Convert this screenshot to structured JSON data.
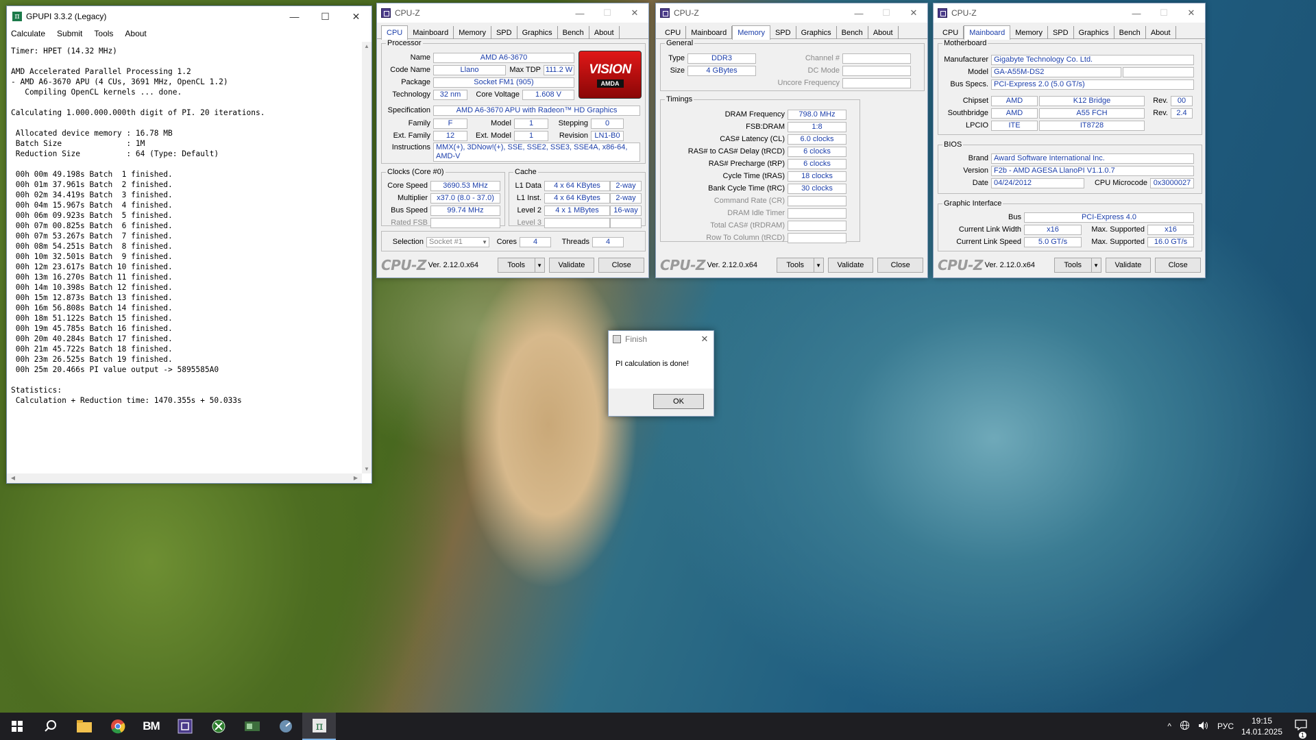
{
  "gpupi": {
    "title": "GPUPI 3.3.2 (Legacy)",
    "menu": [
      "Calculate",
      "Submit",
      "Tools",
      "About"
    ],
    "log": [
      "Timer: HPET (14.32 MHz)",
      "",
      "AMD Accelerated Parallel Processing 1.2",
      "- AMD A6-3670 APU (4 CUs, 3691 MHz, OpenCL 1.2)",
      "   Compiling OpenCL kernels ... done.",
      "",
      "Calculating 1.000.000.000th digit of PI. 20 iterations.",
      "",
      " Allocated device memory : 16.78 MB",
      " Batch Size              : 1M",
      " Reduction Size          : 64 (Type: Default)",
      "",
      " 00h 00m 49.198s Batch  1 finished.",
      " 00h 01m 37.961s Batch  2 finished.",
      " 00h 02m 34.419s Batch  3 finished.",
      " 00h 04m 15.967s Batch  4 finished.",
      " 00h 06m 09.923s Batch  5 finished.",
      " 00h 07m 00.825s Batch  6 finished.",
      " 00h 07m 53.267s Batch  7 finished.",
      " 00h 08m 54.251s Batch  8 finished.",
      " 00h 10m 32.501s Batch  9 finished.",
      " 00h 12m 23.617s Batch 10 finished.",
      " 00h 13m 16.270s Batch 11 finished.",
      " 00h 14m 10.398s Batch 12 finished.",
      " 00h 15m 12.873s Batch 13 finished.",
      " 00h 16m 56.808s Batch 14 finished.",
      " 00h 18m 51.122s Batch 15 finished.",
      " 00h 19m 45.785s Batch 16 finished.",
      " 00h 20m 40.284s Batch 17 finished.",
      " 00h 21m 45.722s Batch 18 finished.",
      " 00h 23m 26.525s Batch 19 finished.",
      " 00h 25m 20.466s PI value output -> 5895585A0",
      "",
      "Statistics:",
      " Calculation + Reduction time: 1470.355s + 50.033s"
    ]
  },
  "cpuz_common": {
    "title": "CPU-Z",
    "tabs": [
      "CPU",
      "Mainboard",
      "Memory",
      "SPD",
      "Graphics",
      "Bench",
      "About"
    ],
    "logo": "CPU-Z",
    "version": "Ver. 2.12.0.x64",
    "tools": "Tools",
    "validate": "Validate",
    "close": "Close"
  },
  "cpu": {
    "processor_legend": "Processor",
    "name_label": "Name",
    "name": "AMD A6-3670",
    "codename_label": "Code Name",
    "codename": "Llano",
    "maxtdp_label": "Max TDP",
    "maxtdp": "111.2 W",
    "package_label": "Package",
    "package": "Socket FM1 (905)",
    "technology_label": "Technology",
    "technology": "32 nm",
    "voltage_label": "Core Voltage",
    "voltage": "1.608 V",
    "spec_label": "Specification",
    "spec": "AMD A6-3670 APU with Radeon™ HD Graphics",
    "family_label": "Family",
    "family": "F",
    "model_label": "Model",
    "model": "1",
    "stepping_label": "Stepping",
    "stepping": "0",
    "extfamily_label": "Ext. Family",
    "extfamily": "12",
    "extmodel_label": "Ext. Model",
    "extmodel": "1",
    "revision_label": "Revision",
    "revision": "LN1-B0",
    "instructions_label": "Instructions",
    "instructions": "MMX(+), 3DNow!(+), SSE, SSE2, SSE3, SSE4A, x86-64, AMD-V",
    "logo_text": "VISION",
    "logo_sub": "AMDA",
    "clocks_legend": "Clocks (Core #0)",
    "corespeed_label": "Core Speed",
    "corespeed": "3690.53 MHz",
    "multiplier_label": "Multiplier",
    "multiplier": "x37.0 (8.0 - 37.0)",
    "busspeed_label": "Bus Speed",
    "busspeed": "99.74 MHz",
    "ratedfsb_label": "Rated FSB",
    "cache_legend": "Cache",
    "l1d_label": "L1 Data",
    "l1d": "4 x 64 KBytes",
    "l1d_way": "2-way",
    "l1i_label": "L1 Inst.",
    "l1i": "4 x 64 KBytes",
    "l1i_way": "2-way",
    "l2_label": "Level 2",
    "l2": "4 x 1 MBytes",
    "l2_way": "16-way",
    "l3_label": "Level 3",
    "selection_label": "Selection",
    "selection": "Socket #1",
    "cores_label": "Cores",
    "cores": "4",
    "threads_label": "Threads",
    "threads": "4"
  },
  "memory": {
    "general_legend": "General",
    "type_label": "Type",
    "type": "DDR3",
    "size_label": "Size",
    "size": "4 GBytes",
    "channel_label": "Channel #",
    "dcmode_label": "DC Mode",
    "uncore_label": "Uncore Frequency",
    "timings_legend": "Timings",
    "dram_freq_label": "DRAM Frequency",
    "dram_freq": "798.0 MHz",
    "fsb_dram_label": "FSB:DRAM",
    "fsb_dram": "1:8",
    "cl_label": "CAS# Latency (CL)",
    "cl": "6.0 clocks",
    "trcd_label": "RAS# to CAS# Delay (tRCD)",
    "trcd": "6 clocks",
    "trp_label": "RAS# Precharge (tRP)",
    "trp": "6 clocks",
    "tras_label": "Cycle Time (tRAS)",
    "tras": "18 clocks",
    "trc_label": "Bank Cycle Time (tRC)",
    "trc": "30 clocks",
    "cr_label": "Command Rate (CR)",
    "idle_label": "DRAM Idle Timer",
    "trdram_label": "Total CAS# (tRDRAM)",
    "trcd2_label": "Row To Column (tRCD)"
  },
  "mainboard": {
    "mb_legend": "Motherboard",
    "manufacturer_label": "Manufacturer",
    "manufacturer": "Gigabyte Technology Co. Ltd.",
    "model_label": "Model",
    "model": "GA-A55M-DS2",
    "busspecs_label": "Bus Specs.",
    "busspecs": "PCI-Express 2.0 (5.0 GT/s)",
    "chipset_label": "Chipset",
    "chipset_vendor": "AMD",
    "chipset": "K12 Bridge",
    "chipset_rev_label": "Rev.",
    "chipset_rev": "00",
    "southbridge_label": "Southbridge",
    "sb_vendor": "AMD",
    "sb": "A55 FCH",
    "sb_rev_label": "Rev.",
    "sb_rev": "2.4",
    "lpcio_label": "LPCIO",
    "lpcio_vendor": "ITE",
    "lpcio": "IT8728",
    "bios_legend": "BIOS",
    "brand_label": "Brand",
    "brand": "Award Software International Inc.",
    "version_label": "Version",
    "version": "F2b - AMD AGESA LlanoPI V1.1.0.7",
    "date_label": "Date",
    "date": "04/24/2012",
    "microcode_label": "CPU Microcode",
    "microcode": "0x3000027",
    "gi_legend": "Graphic Interface",
    "bus_label": "Bus",
    "bus": "PCI-Express 4.0",
    "linkwidth_label": "Current Link Width",
    "linkwidth": "x16",
    "maxwidth_label": "Max. Supported",
    "maxwidth": "x16",
    "linkspeed_label": "Current Link Speed",
    "linkspeed": "5.0 GT/s",
    "maxspeed_label": "Max. Supported",
    "maxspeed": "16.0 GT/s"
  },
  "dialog": {
    "title": "Finish",
    "message": "PI calculation is done!",
    "ok": "OK"
  },
  "taskbar": {
    "language": "РУС",
    "time": "19:15",
    "date": "14.01.2025",
    "notification_count": "1"
  }
}
